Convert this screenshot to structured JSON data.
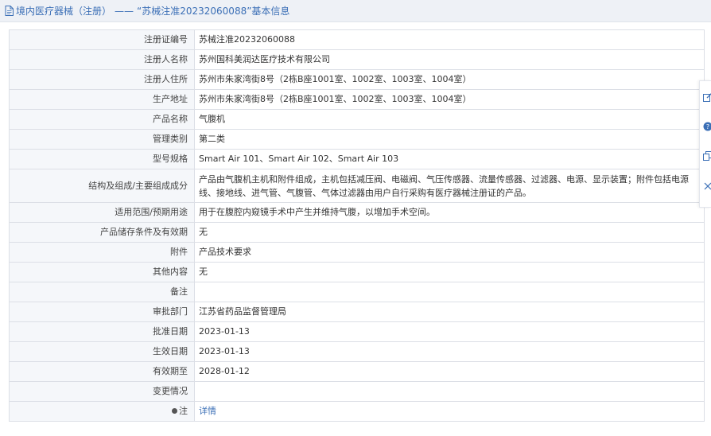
{
  "header": {
    "crumb": "境内医疗器械（注册）",
    "separator": "——",
    "title": "“苏械注准20232060088”基本信息"
  },
  "rows": [
    {
      "label": "注册证编号",
      "value": "苏械注准20232060088"
    },
    {
      "label": "注册人名称",
      "value": "苏州国科美润达医疗技术有限公司"
    },
    {
      "label": "注册人住所",
      "value": "苏州市朱家湾街8号（2栋B座1001室、1002室、1003室、1004室）"
    },
    {
      "label": "生产地址",
      "value": "苏州市朱家湾街8号（2栋B座1001室、1002室、1003室、1004室）"
    },
    {
      "label": "产品名称",
      "value": "气腹机"
    },
    {
      "label": "管理类别",
      "value": "第二类"
    },
    {
      "label": "型号规格",
      "value": "Smart Air 101、Smart Air 102、Smart Air 103"
    },
    {
      "label": "结构及组成/主要组成成分",
      "value": "产品由气腹机主机和附件组成，主机包括减压阀、电磁阀、气压传感器、流量传感器、过滤器、电源、显示装置；附件包括电源线、接地线、进气管、气腹管、气体过滤器由用户自行采购有医疗器械注册证的产品。"
    },
    {
      "label": "适用范围/预期用途",
      "value": "用于在腹腔内窥镜手术中产生并维持气腹，以增加手术空间。"
    },
    {
      "label": "产品储存条件及有效期",
      "value": "无"
    },
    {
      "label": "附件",
      "value": "产品技术要求"
    },
    {
      "label": "其他内容",
      "value": "无"
    },
    {
      "label": "备注",
      "value": ""
    },
    {
      "label": "审批部门",
      "value": "江苏省药品监督管理局"
    },
    {
      "label": "批准日期",
      "value": "2023-01-13"
    },
    {
      "label": "生效日期",
      "value": "2023-01-13"
    },
    {
      "label": "有效期至",
      "value": "2028-01-12"
    },
    {
      "label": "变更情况",
      "value": ""
    }
  ],
  "note_row": {
    "label": "注",
    "link": "详情"
  },
  "side_toolbar": [
    "edit-icon",
    "help-icon",
    "copy-icon",
    "close-icon"
  ],
  "colors": {
    "accent": "#3b6fb6",
    "label_bg": "#f5f7fa",
    "border": "#dcdfe6",
    "header_bg": "#eef1f6"
  }
}
